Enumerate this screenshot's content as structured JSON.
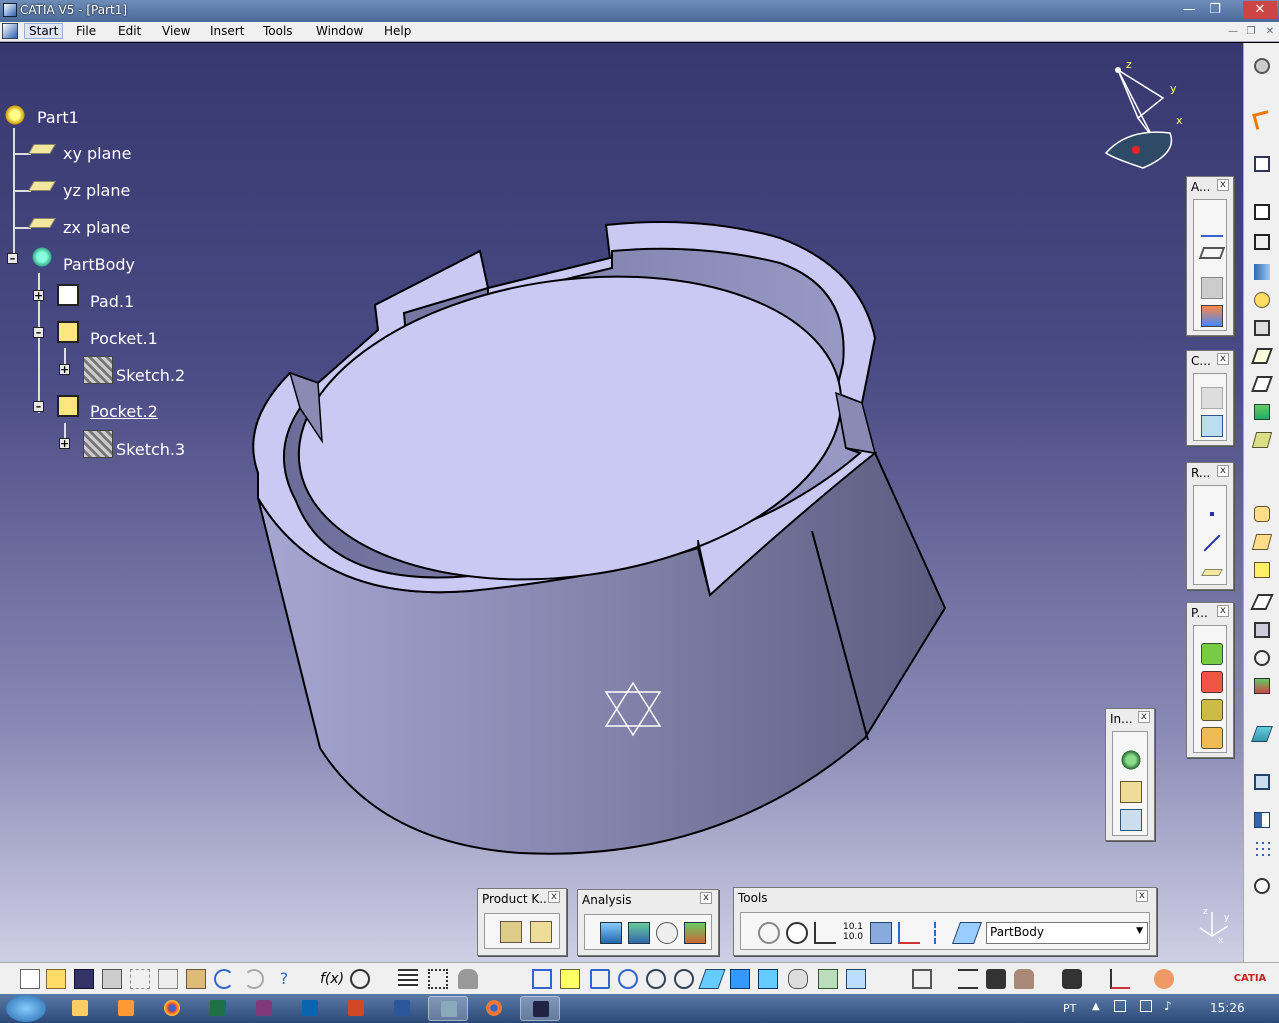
{
  "window": {
    "title": "CATIA V5 - [Part1]"
  },
  "menu": {
    "items": [
      "Start",
      "File",
      "Edit",
      "View",
      "Insert",
      "Tools",
      "Window",
      "Help"
    ],
    "active": "Start"
  },
  "tree": {
    "root": "Part1",
    "planes": [
      "xy plane",
      "yz plane",
      "zx plane"
    ],
    "body": "PartBody",
    "features": [
      "Pad.1",
      "Pocket.1",
      "Sketch.2",
      "Pocket.2",
      "Sketch.3"
    ]
  },
  "compass": {
    "axes": [
      "z",
      "y",
      "x"
    ]
  },
  "toolbars": {
    "annotation": "A...",
    "constraint": "C...",
    "reference": "R...",
    "product": "P...",
    "insert": "In...",
    "product_knowledge": "Product K...",
    "analysis": "Analysis",
    "tools": "Tools",
    "close": "x",
    "body_select": "PartBody"
  },
  "viewport": {
    "part_color": "#c9c9f4",
    "background_top": "#383870",
    "background_bottom": "#cfcfe6"
  },
  "taskbar": {
    "lang": "PT",
    "time": "15:26"
  },
  "icons": [
    "catia-logo-icon",
    "undo-icon",
    "redo-icon",
    "camera-icon"
  ]
}
